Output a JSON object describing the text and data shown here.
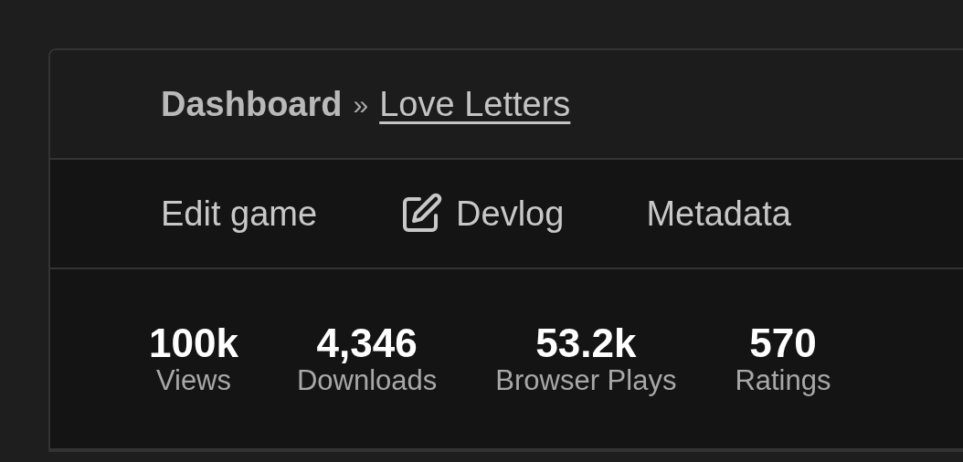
{
  "breadcrumb": {
    "root": "Dashboard",
    "separator": "»",
    "current": "Love Letters"
  },
  "nav": [
    {
      "label": "Edit game",
      "kind": "text"
    },
    {
      "label": "Devlog",
      "kind": "icon"
    },
    {
      "label": "Metadata",
      "kind": "text"
    }
  ],
  "stats": [
    {
      "value": "100k",
      "label": "Views"
    },
    {
      "value": "4,346",
      "label": "Downloads"
    },
    {
      "value": "53.2k",
      "label": "Browser Plays"
    },
    {
      "value": "570",
      "label": "Ratings"
    }
  ]
}
